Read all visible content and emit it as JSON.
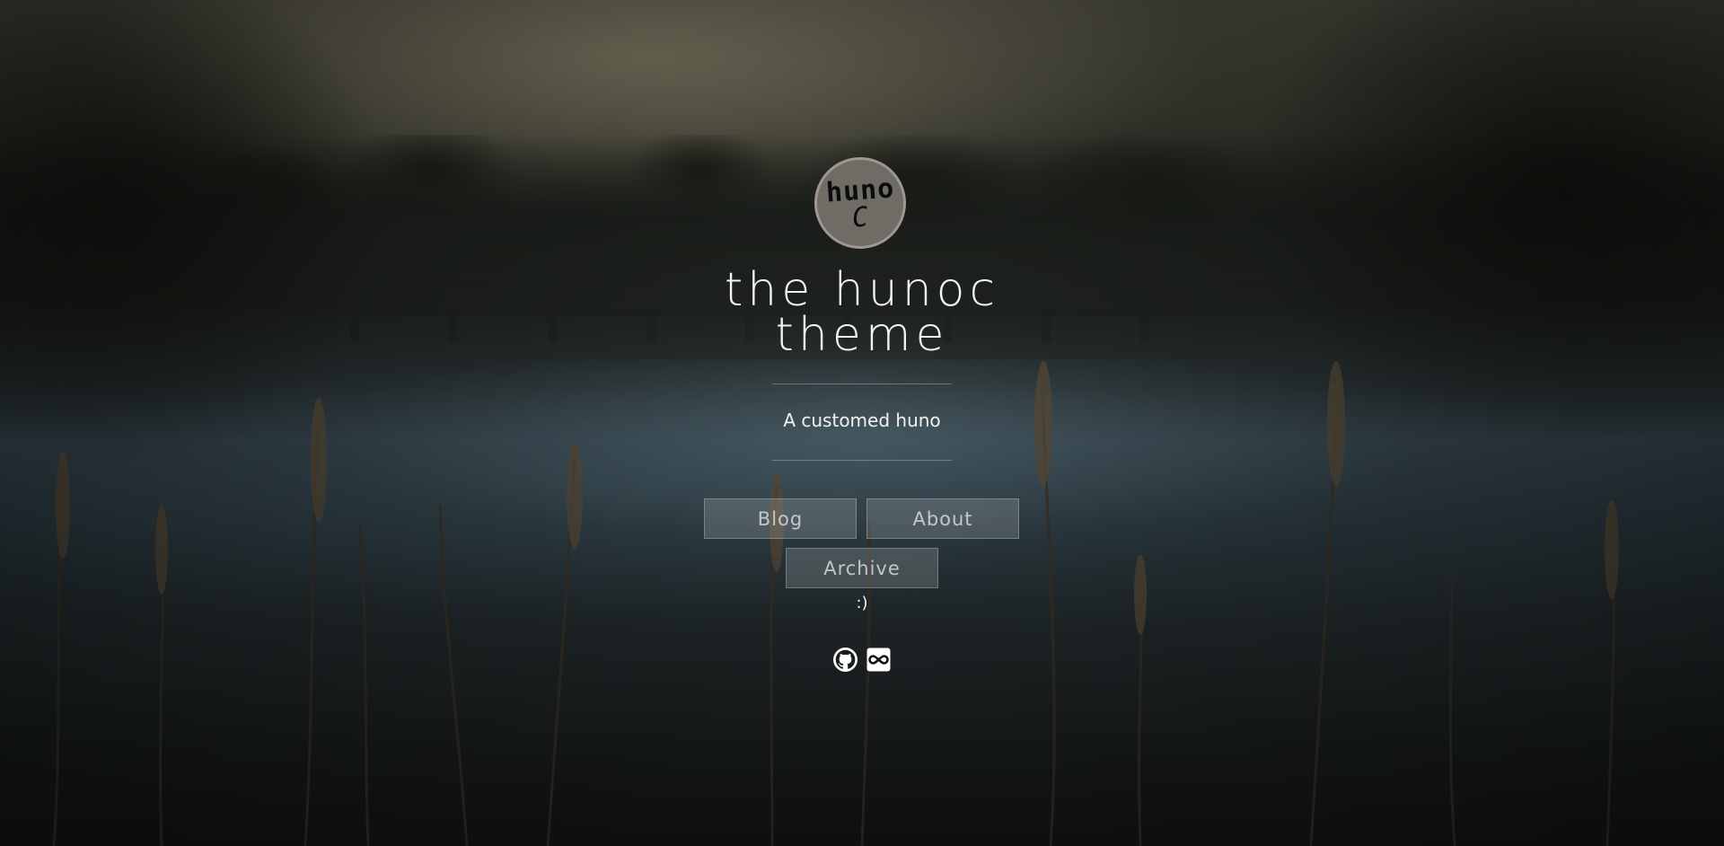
{
  "site": {
    "avatar_line1": "huno",
    "avatar_line2": "C",
    "title": "the hunoc theme",
    "subtitle": "A customed huno"
  },
  "nav": {
    "items": [
      {
        "label": "Blog"
      },
      {
        "label": "About"
      },
      {
        "label": "Archive"
      }
    ]
  },
  "footer": {
    "tagline": ":)",
    "social": [
      {
        "icon": "github-icon"
      },
      {
        "icon": "infinity-icon"
      }
    ]
  },
  "colors": {
    "overlay_button_bg": "#ffffff29",
    "avatar_border": "#9f9794",
    "text": "#ffffff"
  }
}
